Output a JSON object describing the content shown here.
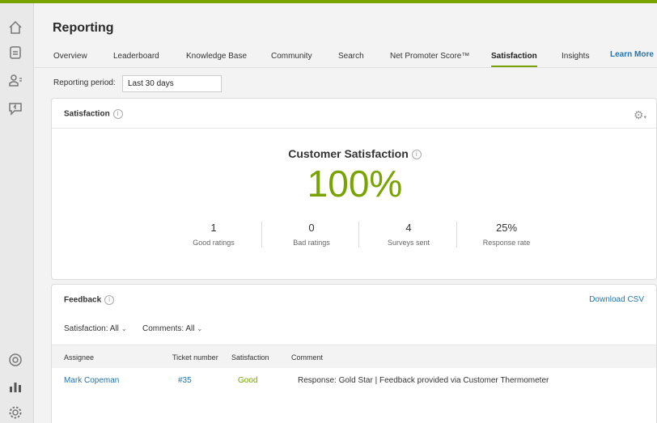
{
  "sidebar": {
    "items": [
      {
        "icon": "home-icon"
      },
      {
        "icon": "tickets-icon"
      },
      {
        "icon": "users-icon"
      },
      {
        "icon": "chat-icon"
      },
      {
        "icon": "help-center-icon"
      },
      {
        "icon": "reporting-icon"
      },
      {
        "icon": "settings-icon"
      }
    ]
  },
  "header": {
    "title": "Reporting"
  },
  "tabs": [
    {
      "label": "Overview"
    },
    {
      "label": "Leaderboard"
    },
    {
      "label": "Knowledge Base"
    },
    {
      "label": "Community"
    },
    {
      "label": "Search"
    },
    {
      "label": "Net Promoter Score™"
    },
    {
      "label": "Satisfaction",
      "active": true
    },
    {
      "label": "Insights"
    }
  ],
  "learn_more": "Learn More",
  "reporting_period": {
    "label": "Reporting period:",
    "value": "Last 30 days"
  },
  "satisfaction_card": {
    "title": "Satisfaction",
    "csat_title": "Customer Satisfaction",
    "csat_value": "100%",
    "stats": [
      {
        "value": "1",
        "label": "Good ratings"
      },
      {
        "value": "0",
        "label": "Bad ratings"
      },
      {
        "value": "4",
        "label": "Surveys sent"
      },
      {
        "value": "25%",
        "label": "Response rate"
      }
    ]
  },
  "feedback_card": {
    "title": "Feedback",
    "download": "Download CSV",
    "filters": {
      "satisfaction": "Satisfaction: All",
      "comments": "Comments: All"
    },
    "columns": [
      "Assignee",
      "Ticket number",
      "Satisfaction",
      "Comment"
    ],
    "rows": [
      {
        "assignee": "Mark Copeman",
        "ticket": "#35",
        "satisfaction": "Good",
        "comment": "Response: Gold Star | Feedback provided via Customer Thermometer"
      }
    ]
  },
  "colors": {
    "accent": "#78a300",
    "link": "#1f73b7"
  }
}
